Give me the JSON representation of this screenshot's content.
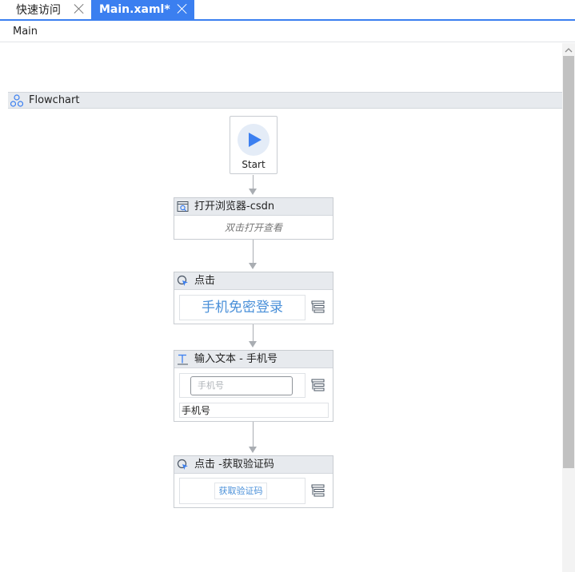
{
  "tabs": [
    {
      "label": "快速访问",
      "active": false
    },
    {
      "label": "Main.xaml*",
      "active": true
    }
  ],
  "breadcrumb": "Main",
  "flowchart": {
    "title": "Flowchart",
    "icon": "flowchart-icon"
  },
  "start_node": {
    "label": "Start",
    "icon": "play-icon"
  },
  "activities": [
    {
      "title": "打开浏览器-csdn",
      "icon": "browser-icon",
      "subtitle": "双击打开查看"
    },
    {
      "title": "点击",
      "icon": "click-target-icon",
      "preview_text": "手机免密登录"
    },
    {
      "title": "输入文本 - 手机号",
      "icon": "text-input-icon",
      "preview_placeholder": "手机号",
      "field_value": "手机号"
    },
    {
      "title": "点击 -获取验证码",
      "icon": "click-target-icon",
      "preview_text": "获取验证码"
    }
  ],
  "colors": {
    "accent": "#3b7ff0",
    "connector": "#a9adb2",
    "preview_text": "#4a90d9"
  }
}
